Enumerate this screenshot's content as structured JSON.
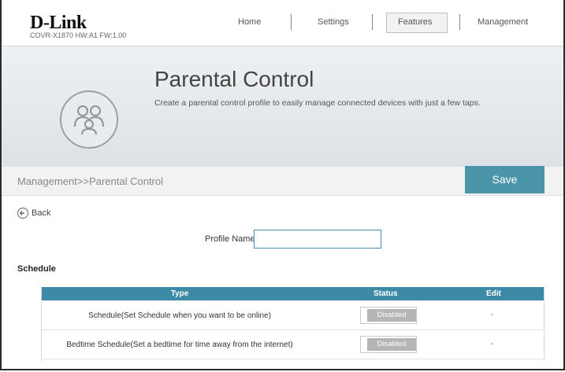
{
  "header": {
    "brand": "D-Link",
    "model_info": "COVR-X1870 HW:A1 FW:1.00",
    "nav": [
      "Home",
      "Settings",
      "Features",
      "Management"
    ],
    "active_nav": "Features"
  },
  "hero": {
    "title": "Parental Control",
    "subtitle": "Create a parental control profile to easily manage connected devices with just a few taps.",
    "icon": "family-icon"
  },
  "breadcrumb": "Management>>Parental Control",
  "actions": {
    "save_label": "Save",
    "back_label": "Back"
  },
  "form": {
    "profile_label": "Profile Name:",
    "profile_value": "",
    "profile_placeholder": ""
  },
  "schedule": {
    "heading": "Schedule",
    "columns": [
      "Type",
      "Status",
      "Edit"
    ],
    "rows": [
      {
        "type": "Schedule(Set Schedule when you want to be online)",
        "status": "Disabled",
        "edit": "-"
      },
      {
        "type": "Bedtime Schedule(Set a bedtime for time away from the internet)",
        "status": "Disabled",
        "edit": "-"
      }
    ]
  },
  "colors": {
    "accent": "#4a95a8",
    "table_header": "#3d8aa6",
    "toggle_off": "#b5b5b5"
  }
}
